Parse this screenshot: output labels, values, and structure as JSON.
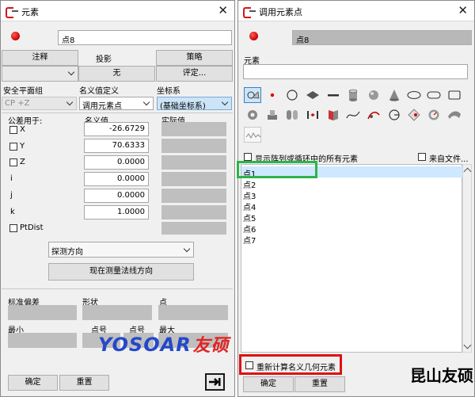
{
  "left_window": {
    "title": "元素",
    "point_name": "点8",
    "top_buttons": {
      "comment": "注释",
      "projection_label": "投影",
      "strategy": "策略"
    },
    "second_row": {
      "projection_value": "无",
      "evaluate": "评定..."
    },
    "col_headers": {
      "safety_plane": "安全平面组",
      "nominal_def": "名义值定义",
      "coord_sys": "坐标系"
    },
    "safety_plane_value": "CP +Z",
    "nominal_def_value": "调用元素点",
    "coord_sys_value": "(基础坐标系)",
    "table_headers": {
      "tolerance": "公差用于:",
      "nominal": "名义值",
      "actual": "实际值"
    },
    "rows": [
      {
        "label": "X",
        "nominal": "-26.6729"
      },
      {
        "label": "Y",
        "nominal": "70.6333"
      },
      {
        "label": "Z",
        "nominal": "0.0000"
      },
      {
        "label": "i",
        "nominal": "0.0000"
      },
      {
        "label": "j",
        "nominal": "0.0000"
      },
      {
        "label": "k",
        "nominal": "1.0000"
      }
    ],
    "ptdist_label": "PtDist",
    "probe_dir": "探测方向",
    "measure_normal_btn": "现在测量法线方向",
    "stats": {
      "std_dev": "标准偏差",
      "form": "形状",
      "point": "点",
      "min": "最小",
      "pt_no1": "点号",
      "pt_no2": "点号",
      "max": "最大"
    },
    "footer": {
      "ok": "确定",
      "reset": "重置"
    }
  },
  "right_window": {
    "title": "调用元素点",
    "point_name": "点8",
    "elements_label": "元素",
    "show_all_label": "显示阵列或循环中的所有元素",
    "from_file_label": "来自文件...",
    "list_items": [
      "点1",
      "点2",
      "点3",
      "点4",
      "点5",
      "点6",
      "点7"
    ],
    "selected_index": 0,
    "recalc_label": "重新计算名义几何元素",
    "footer": {
      "ok": "确定",
      "reset": "重置"
    },
    "tool_icons": [
      "multi-element-icon",
      "point-icon",
      "circle-icon",
      "plane-icon",
      "line-icon",
      "cylinder-icon",
      "cone-icon",
      "sphere-icon",
      "ellipse-icon",
      "slot-icon",
      "rectangle-icon",
      "torus-icon",
      "step-cylinder-icon",
      "two-cylinders-icon",
      "symmetry-point-icon",
      "book-icon",
      "curve-icon",
      "chart-icon",
      "angle-gauge-icon",
      "paint-icon",
      "gauge-icon",
      "wing-icon",
      "waveform-icon"
    ]
  },
  "watermark": {
    "latin": "YOSOAR",
    "cn": "友硕"
  },
  "overlay_text": "昆山友硕",
  "colors": {
    "green_highlight": "#2eb44a",
    "red_highlight": "#e01010",
    "selection": "#cde8ff",
    "watermark_blue": "#2448c8",
    "watermark_red": "#e02424"
  }
}
